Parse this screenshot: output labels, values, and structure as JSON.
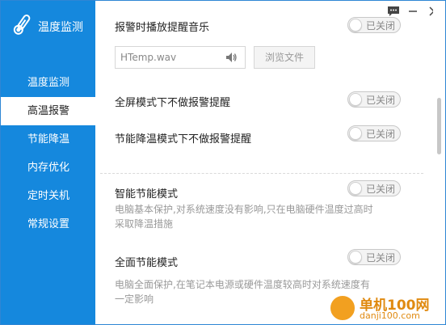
{
  "app": {
    "title": "温度监测",
    "colors": {
      "sidebar": "#1588dd",
      "accent": "#2e86d4"
    }
  },
  "sidebar": {
    "items": [
      {
        "label": "温度监测",
        "active": false
      },
      {
        "label": "高温报警",
        "active": true
      },
      {
        "label": "节能降温",
        "active": false
      },
      {
        "label": "内存优化",
        "active": false
      },
      {
        "label": "定时关机",
        "active": false
      },
      {
        "label": "常规设置",
        "active": false
      }
    ]
  },
  "titlebar": {
    "icons": [
      "feedback-icon",
      "minimize-icon",
      "close-icon"
    ]
  },
  "settings": {
    "alarm_music": {
      "label": "报警时播放提醒音乐",
      "toggle": "已关闭"
    },
    "sound_file": {
      "value": "HTemp.wav",
      "browse_label": "浏览文件"
    },
    "fullscreen": {
      "label": "全屏模式下不做报警提醒",
      "toggle": "已关闭"
    },
    "eco_mode_alarm": {
      "label": "节能降温模式下不做报警提醒",
      "toggle": "已关闭"
    },
    "smart_eco": {
      "label": "智能节能模式",
      "toggle": "已关闭",
      "desc": "电脑基本保护,对系统速度没有影响,只在电脑硬件温度过高时采取降温措施"
    },
    "full_eco": {
      "label": "全面节能模式",
      "toggle": "已关闭",
      "desc": "电脑全面保护,在笔记本电源或硬件温度较高时对系统速度有一定影响"
    }
  },
  "watermark": {
    "line1": "单机100网",
    "line2": "danji100.com"
  }
}
